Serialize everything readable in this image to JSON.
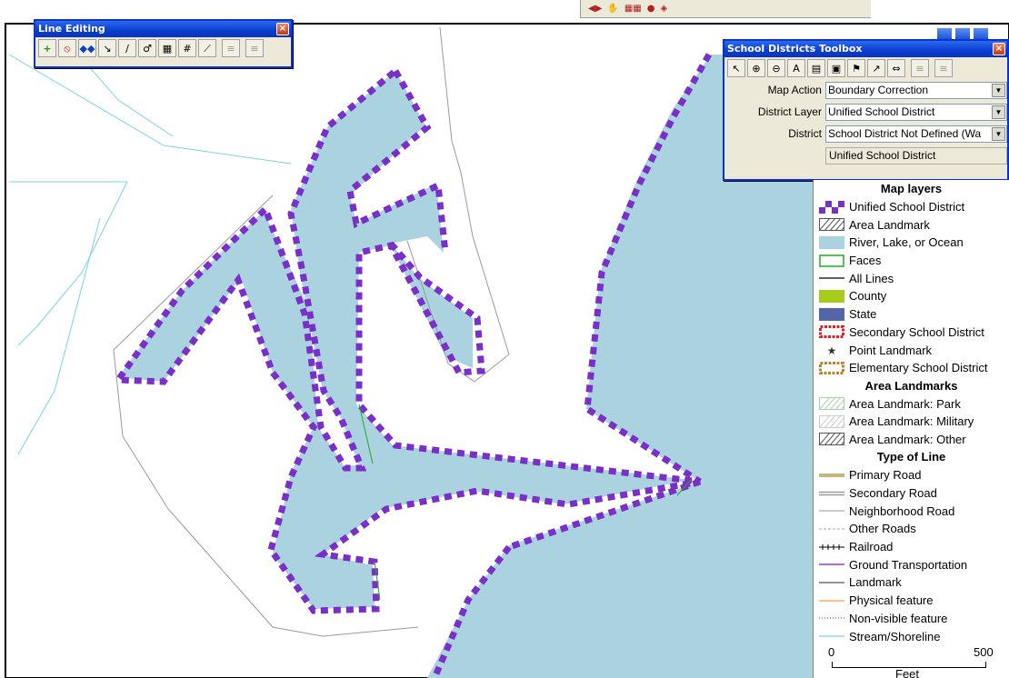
{
  "line_editing": {
    "title": "Line Editing",
    "close": "×",
    "tools": [
      {
        "icon": "add-icon",
        "glyph": "+"
      },
      {
        "icon": "stop-icon",
        "glyph": "⦸"
      },
      {
        "icon": "move-icon",
        "glyph": "◆◆"
      },
      {
        "icon": "delete-vertex-icon",
        "glyph": "↘"
      },
      {
        "icon": "reshape-icon",
        "glyph": "∕"
      },
      {
        "icon": "split-icon",
        "glyph": "♂"
      },
      {
        "icon": "attributes-icon",
        "glyph": "▦"
      },
      {
        "icon": "number-icon",
        "glyph": "#"
      },
      {
        "icon": "flip-icon",
        "glyph": "⟋"
      },
      {
        "icon": "grip-left-icon",
        "glyph": "≡"
      },
      {
        "icon": "grip-right-icon",
        "glyph": "≡"
      }
    ]
  },
  "toolbox": {
    "title": "School Districts Toolbox",
    "close": "×",
    "tools": [
      {
        "icon": "select-icon",
        "glyph": "↖"
      },
      {
        "icon": "zoom-in-icon",
        "glyph": "⊕"
      },
      {
        "icon": "zoom-out-icon",
        "glyph": "⊖"
      },
      {
        "icon": "annotation-icon",
        "glyph": "A"
      },
      {
        "icon": "report-icon",
        "glyph": "▤"
      },
      {
        "icon": "document-icon",
        "glyph": "▣"
      },
      {
        "icon": "flag-icon",
        "glyph": "⚑"
      },
      {
        "icon": "pointer-icon",
        "glyph": "↗"
      },
      {
        "icon": "merge-icon",
        "glyph": "⇔"
      },
      {
        "icon": "grip-left-icon",
        "glyph": "≡"
      },
      {
        "icon": "grip-right-icon",
        "glyph": "≡"
      }
    ],
    "map_action_label": "Map Action",
    "map_action_value": "Boundary Correction",
    "district_layer_label": "District Layer",
    "district_layer_value": "Unified School District",
    "district_label": "District",
    "district_value": "School District Not Defined (Wa",
    "selected_value": "Unified School District"
  },
  "legend": {
    "heading_map_layers": "Map layers",
    "map_layers": [
      {
        "label": "Unified School District",
        "swatch": "checker-purple",
        "color": "#7b2fc9"
      },
      {
        "label": "Area Landmark",
        "swatch": "hatch",
        "color": "#555555"
      },
      {
        "label": "River, Lake, or Ocean",
        "swatch": "fill",
        "color": "#aad3df"
      },
      {
        "label": "Faces",
        "swatch": "outline",
        "color": "#22aa22"
      },
      {
        "label": "All Lines",
        "swatch": "line",
        "color": "#000000"
      },
      {
        "label": "County",
        "swatch": "fill",
        "color": "#a8cc1c"
      },
      {
        "label": "State",
        "swatch": "fill",
        "color": "#5466a8"
      },
      {
        "label": "Secondary School District",
        "swatch": "dash-box",
        "color": "#e02020"
      },
      {
        "label": "Point Landmark",
        "swatch": "star",
        "color": "#333333"
      },
      {
        "label": "Elementary School District",
        "swatch": "dash-box",
        "color": "#b8862a"
      }
    ],
    "heading_area_landmarks": "Area Landmarks",
    "area_landmarks": [
      {
        "label": "Area Landmark: Park",
        "swatch": "hatch",
        "color": "#a6d6a0"
      },
      {
        "label": "Area Landmark: Military",
        "swatch": "hatch",
        "color": "#cccccc"
      },
      {
        "label": "Area Landmark: Other",
        "swatch": "hatch",
        "color": "#555555"
      }
    ],
    "heading_type_of_line": "Type of Line",
    "line_types": [
      {
        "label": "Primary Road",
        "swatch": "thick",
        "color": "#c8b878"
      },
      {
        "label": "Secondary Road",
        "swatch": "double",
        "color": "#999999"
      },
      {
        "label": "Neighborhood Road",
        "swatch": "line",
        "color": "#aaaaaa"
      },
      {
        "label": "Other Roads",
        "swatch": "dashed",
        "color": "#aaaaaa"
      },
      {
        "label": "Railroad",
        "swatch": "rail",
        "color": "#000000"
      },
      {
        "label": "Ground Transportation",
        "swatch": "line",
        "color": "#7a1fa0"
      },
      {
        "label": "Landmark",
        "swatch": "line",
        "color": "#555555"
      },
      {
        "label": "Physical feature",
        "swatch": "line",
        "color": "#f0a040"
      },
      {
        "label": "Non-visible feature",
        "swatch": "dotted",
        "color": "#555555"
      },
      {
        "label": "Stream/Shoreline",
        "swatch": "line",
        "color": "#7ed0ee"
      }
    ],
    "scale_start": "0",
    "scale_end": "500",
    "scale_unit": "Feet"
  },
  "colors": {
    "water": "#aad3df",
    "boundary": "#7b2fc9",
    "title_bar": "#0a3ccf"
  }
}
